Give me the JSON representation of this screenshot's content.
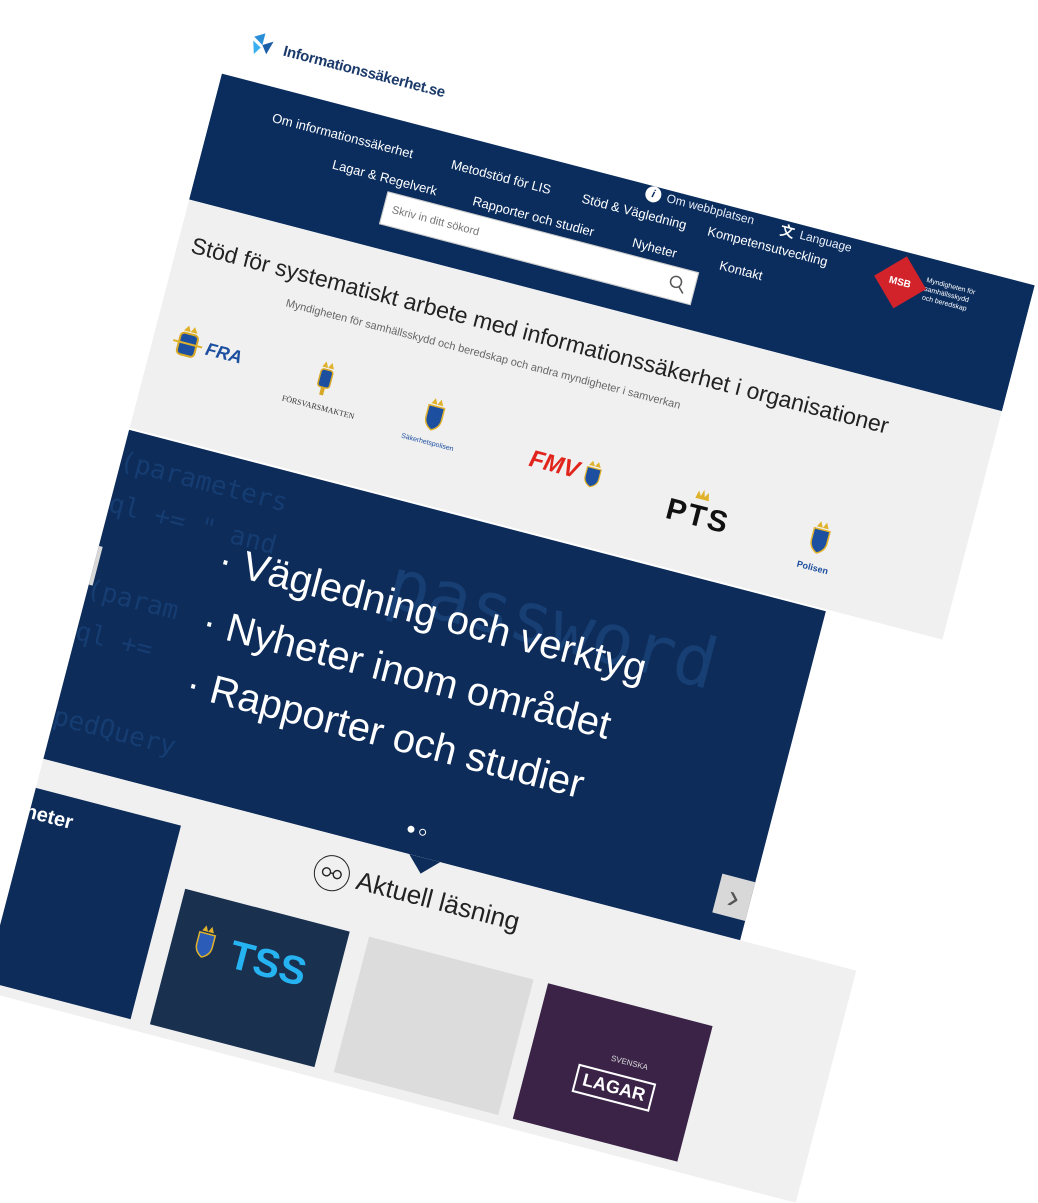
{
  "header": {
    "site_name": "Informationssäkerhet.se"
  },
  "nav": {
    "row1": [
      "Om informationssäkerhet",
      "Metodstöd för LIS",
      "Stöd & Vägledning",
      "Kompetensutveckling"
    ],
    "row2": [
      "Lagar & Regelverk",
      "Rapporter och studier",
      "Nyheter",
      "Kontakt"
    ],
    "utility": {
      "about": "Om webbplatsen",
      "language": "Language"
    },
    "msb": {
      "badge": "MSB",
      "tagline": "Myndigheten för samhällsskydd och beredskap"
    }
  },
  "search": {
    "placeholder": "Skriv in ditt sökord"
  },
  "band": {
    "title": "Stöd för systematiskt arbete med informationssäkerhet i organisationer",
    "subtitle": "Myndigheten för samhällsskydd och beredskap och andra myndigheter i samverkan"
  },
  "partners": [
    {
      "name": "FRA"
    },
    {
      "name": "FÖRSVARSMAKTEN"
    },
    {
      "name": "Säkerhetspolisen"
    },
    {
      "name": "FMV"
    },
    {
      "name": "PTS"
    },
    {
      "name": "Polisen"
    }
  ],
  "hero": {
    "bullets": [
      "Vägledning och verktyg",
      "Nyheter inom området",
      "Rapporter och studier"
    ],
    "code_lines": [
      "if(parameters",
      " hql += \" and ",
      "}",
      "if(param",
      " hql +=",
      "}",
      "TypedQuery"
    ],
    "watermark": "password",
    "prev_icon": "chevron-left-icon",
    "next_icon": "chevron-right-icon",
    "slide_count": 2,
    "active_slide": 1
  },
  "news": {
    "title": "Nyheter"
  },
  "reading": {
    "title": "Aktuell läsning",
    "icon": "glasses-icon"
  },
  "cards": [
    {
      "label": "TSS"
    },
    {
      "label": ""
    },
    {
      "label": "LAGAR",
      "top_label": "SVENSKA"
    }
  ],
  "colors": {
    "nav": "#0b2d5e",
    "hero": "#0d2c5a",
    "band": "#f0f0f0",
    "msb_red": "#d2232a",
    "fmv_red": "#e1241c"
  }
}
